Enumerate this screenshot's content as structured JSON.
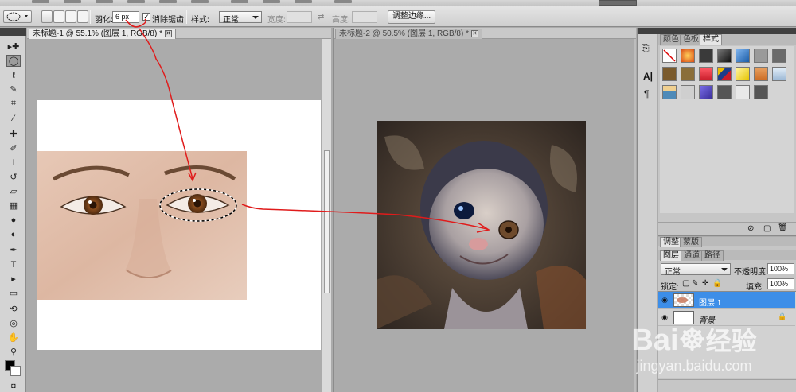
{
  "options_bar": {
    "feather_label": "羽化:",
    "feather_value": "6 px",
    "antialias_label": "消除锯齿",
    "antialias_checked": "✓",
    "style_label": "样式:",
    "style_value": "正常",
    "width_label": "宽度:",
    "height_label": "高度:",
    "refine_edge_button": "调整边缘..."
  },
  "toolbox": {
    "tools": [
      "move-tool",
      "marquee-tool",
      "lasso-tool",
      "quick-selection-tool",
      "crop-tool",
      "eyedropper-tool",
      "spot-healing-tool",
      "brush-tool",
      "clone-stamp-tool",
      "history-brush-tool",
      "eraser-tool",
      "gradient-tool",
      "blur-tool",
      "dodge-tool",
      "pen-tool",
      "type-tool",
      "path-selection-tool",
      "shape-tool",
      "3d-rotate-tool",
      "3d-orbit-tool",
      "hand-tool",
      "zoom-tool"
    ],
    "foreground_color": "#000000",
    "background_color": "#ffffff"
  },
  "documents": [
    {
      "tab_title": "未标题-1 @ 55.1% (图层 1, RGB/8) *",
      "active": true
    },
    {
      "tab_title": "未标题-2 @ 50.5% (图层 1, RGB/8) *",
      "active": false
    }
  ],
  "swatches_panel": {
    "tabs": [
      "颜色",
      "色板",
      "样式"
    ],
    "active_tab": "样式",
    "style_colors": [
      "#ffffff",
      "#d94c16",
      "#3a3a3a",
      "#2b2b2b",
      "#1b5da8",
      "#9a9a9a",
      "#6a6a6a",
      "#7a5a2c",
      "#8a6e3a",
      "#c81d2a",
      "#1d3c8a",
      "#e6c400",
      "#cc6c24",
      "#9bb7d4",
      "#4e8ab8",
      "#cfcfcf",
      "#3a2e9a",
      "#555555",
      "#e8e8e8",
      "#555555"
    ]
  },
  "layers_panel": {
    "top_tabs": [
      "调整",
      "蒙版"
    ],
    "tabs": [
      "图层",
      "通道",
      "路径"
    ],
    "active_tab": "图层",
    "blend_mode": "正常",
    "opacity_label": "不透明度:",
    "opacity_value": "100%",
    "lock_label": "锁定:",
    "fill_label": "填充:",
    "fill_value": "100%",
    "layers": [
      {
        "name": "图层 1",
        "selected": true
      },
      {
        "name": "背景",
        "selected": false,
        "locked": true
      }
    ]
  },
  "watermark": {
    "brand": "Bai",
    "suffix": "经验",
    "url": "jingyan.baidu.com"
  }
}
